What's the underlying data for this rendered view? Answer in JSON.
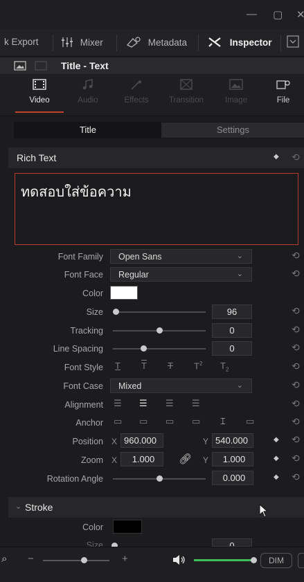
{
  "window": {
    "minimize": "—",
    "restore": "▢",
    "close": "✕"
  },
  "topnav": {
    "quick_export": "k Export",
    "mixer": "Mixer",
    "metadata": "Metadata",
    "inspector": "Inspector"
  },
  "clip": {
    "title": "Title - Text"
  },
  "tabs": [
    {
      "label": "Video",
      "active": true
    },
    {
      "label": "Audio",
      "active": false
    },
    {
      "label": "Effects",
      "active": false
    },
    {
      "label": "Transition",
      "active": false
    },
    {
      "label": "Image",
      "active": false
    },
    {
      "label": "File",
      "active": false
    }
  ],
  "segments": {
    "title": "Title",
    "settings": "Settings"
  },
  "rich_text": {
    "header": "Rich Text",
    "content": "ทดสอบใส่ข้อความ"
  },
  "props": {
    "font_family_label": "Font Family",
    "font_family_value": "Open Sans",
    "font_face_label": "Font Face",
    "font_face_value": "Regular",
    "color_label": "Color",
    "color_value": "#ffffff",
    "size_label": "Size",
    "size_value": "96",
    "tracking_label": "Tracking",
    "tracking_value": "0",
    "line_spacing_label": "Line Spacing",
    "line_spacing_value": "0",
    "font_style_label": "Font Style",
    "font_case_label": "Font Case",
    "font_case_value": "Mixed",
    "alignment_label": "Alignment",
    "anchor_label": "Anchor",
    "position_label": "Position",
    "position_x_axis": "X",
    "position_x": "960.000",
    "position_y_axis": "Y",
    "position_y": "540.000",
    "zoom_label": "Zoom",
    "zoom_x_axis": "X",
    "zoom_x": "1.000",
    "zoom_y_axis": "Y",
    "zoom_y": "1.000",
    "rotation_label": "Rotation Angle",
    "rotation_value": "0.000"
  },
  "stroke": {
    "header": "Stroke",
    "color_label": "Color",
    "color_value": "#000000",
    "size_label": "Size",
    "size_value": "0"
  },
  "bottom": {
    "dim": "DIM",
    "zoom_minus": "−",
    "zoom_plus": "+"
  },
  "accent": "#c2402e"
}
